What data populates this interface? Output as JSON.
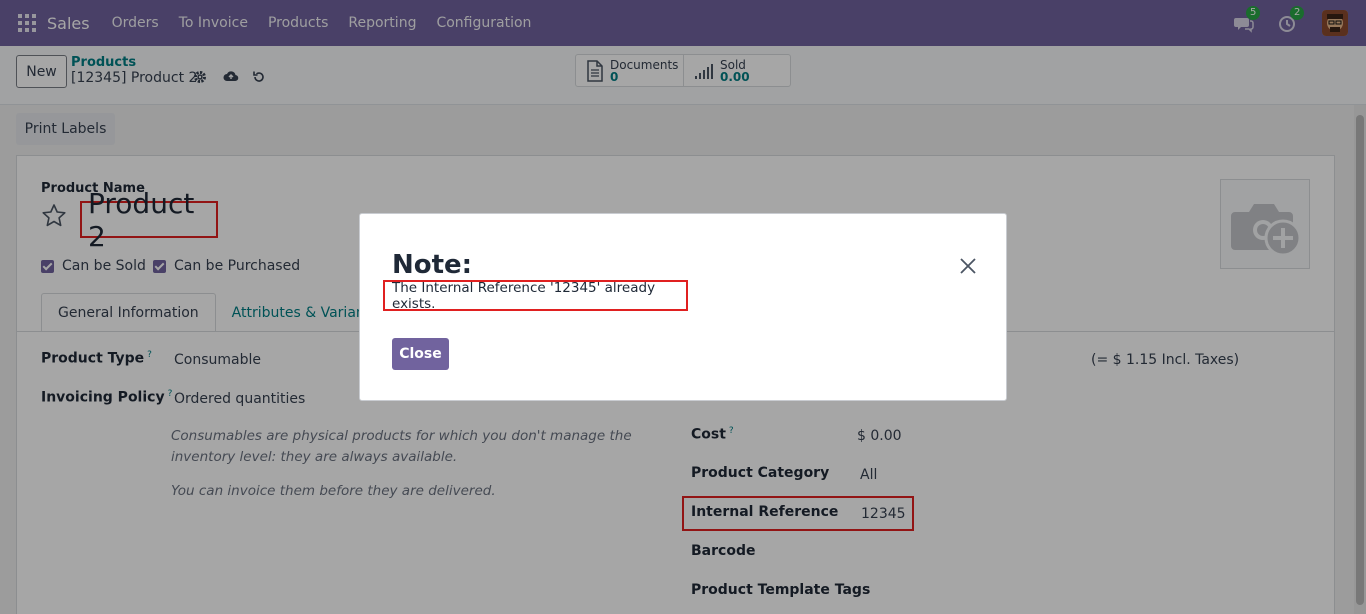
{
  "navbar": {
    "app_name": "Sales",
    "menu": [
      "Orders",
      "To Invoice",
      "Products",
      "Reporting",
      "Configuration"
    ],
    "messages_count": "5",
    "activities_count": "2"
  },
  "control": {
    "new_label": "New",
    "breadcrumb_parent": "Products",
    "record_title": "[12345] Product 2",
    "documents_label": "Documents",
    "documents_value": "0",
    "sold_label": "Sold",
    "sold_value": "0.00"
  },
  "actions": {
    "print_labels": "Print Labels"
  },
  "form": {
    "product_name_label": "Product Name",
    "product_name": "Product 2",
    "can_be_sold": "Can be Sold",
    "can_be_purchased": "Can be Purchased",
    "tabs": [
      "General Information",
      "Attributes & Variants"
    ],
    "product_type_label": "Product Type",
    "product_type_help": "?",
    "product_type_value": "Consumable",
    "invoicing_policy_label": "Invoicing Policy",
    "invoicing_policy_help": "?",
    "invoicing_policy_value": "Ordered quantities",
    "help_text_1": "Consumables are physical products for which you don't manage the inventory level: they are always available.",
    "help_text_2": "You can invoice them before they are delivered.",
    "incl_taxes": "(= $ 1.15 Incl. Taxes)",
    "cost_label": "Cost",
    "cost_help": "?",
    "cost_value": "$ 0.00",
    "category_label": "Product Category",
    "category_value": "All",
    "internal_ref_label": "Internal Reference",
    "internal_ref_value": "12345",
    "barcode_label": "Barcode",
    "tags_label": "Product Template Tags"
  },
  "modal": {
    "title": "Note:",
    "message": "The Internal Reference '12345' already exists.",
    "close_label": "Close"
  },
  "colors": {
    "brand": "#71639e",
    "link": "#017e84",
    "highlight": "#e02020"
  }
}
